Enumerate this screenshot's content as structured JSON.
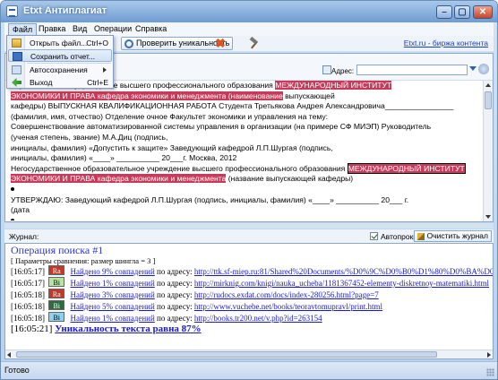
{
  "window": {
    "title": "Etxt Антиплагиат",
    "min_label": "–",
    "max_label": "▢",
    "close_label": "✕"
  },
  "menu": {
    "file": "Файл",
    "edit": "Правка",
    "view": "Вид",
    "operations": "Операции",
    "help": "Справка"
  },
  "file_menu": {
    "open": "Открыть файл...",
    "open_shortcut": "Ctrl+O",
    "save": "Сохранить отчет...",
    "autosave": "Автосохранения",
    "exit": "Выход",
    "exit_shortcut": "Ctrl+E"
  },
  "toolbar": {
    "check_button": "Проверить уникальность",
    "site_link": "Etxt.ru - биржа контента"
  },
  "address": {
    "label": "Адрес:",
    "value": ""
  },
  "document": {
    "l1a": "образовательное учреждение  высшего профессионального образования ",
    "l1b": "МЕЖДУНАРОДНЫЙ ИНСТИТУТ",
    "l2a": "ЭКОНОМИКИ И ПРАВА ",
    "l2b": "              кафедра экономики и менеджмента",
    "l2c": "              ",
    "l2d": "(наименование",
    "l2e": " выпускающей",
    "l3": "кафедры)   ВЫПУСКНАЯ КВАЛИФИКАЦИОННАЯ РАБОТА    Студента          Третьякова Андрея Александровича________________",
    "l4": "                              (фамилия, имя, отчество) Отделение      очное     Факультет экономики и управления на тему:",
    "l5": "Совершенствование автоматизированной системы управления в организации (на примере СФ МИЭП)    Руководитель",
    "l6": "                                         (ученая степень, звание)                                    М.А.Диц            (подпись,",
    "l7": "инициалы, фамилия)  «Допустить к защите» Заведующий  кафедрой                                     Л.П.Шургая (подпись,",
    "l8": "инициалы, фамилия) «____» __________ 20___г.      Москва, 2012",
    "l9a": "Негосударственное образовательное учреждение  высшего профессионального образования ",
    "l9b": "МЕЖДУНАРОДНЫЙ ИНСТИТУТ",
    "l10a": "ЭКОНОМИКИ И ПРАВА",
    "l10b": " кафедра экономики и менеджмента",
    "l10c": " (название выпускающей кафедры)",
    "l12": "УТВЕРЖДАЮ: Заведующий  кафедрой                Л.П.Шургая          (подпись, инициалы, фамилия)  «____» __________ 20___ г.",
    "l13": "(дата"
  },
  "journal": {
    "label": "Журнал:",
    "autoscroll_label": "Автопрокрутка",
    "autoscroll_checked": true,
    "clear_button": "Очистить журнал",
    "op_title": "Операция поиска #1",
    "params": "[ Параметры сравнения: размер шингла = 3 ]",
    "entries": [
      {
        "time": "[16:05:17]",
        "badge": "Ra",
        "badge_color": "#c0392b",
        "badge_text_color": "#ffffff",
        "text": "Найдено 9% совпадений",
        "suffix": " по адресу: ",
        "url": "http://ttk.sf-miep.ru:81/Shared%20Documents/%D0%9C%D0%B0%D1%80%D0%BA%D0%B5"
      },
      {
        "time": "[16:05:17]",
        "badge": "Bi",
        "badge_color": "#b7e4a3",
        "badge_text_color": "#000000",
        "text": "Найдено 1% совпадений",
        "suffix": " по адресу: ",
        "url": "http://mirknig.com/knigi/nauka_ucheba/1181367452-elementy-diskretnoy-matematiki.html"
      },
      {
        "time": "[16:05:18]",
        "badge": "Ra",
        "badge_color": "#c0392b",
        "badge_text_color": "#ffffff",
        "text": "Найдено 3% совпадений",
        "suffix": " по адресу: ",
        "url": "http://rudocs.exdat.com/docs/index-280256.html?page=7"
      },
      {
        "time": "[16:05:18]",
        "badge": "Bi",
        "badge_color": "#2e6b43",
        "badge_text_color": "#ffffff",
        "text": "Найдено 5% совпадений",
        "suffix": " по адресу: ",
        "url": "http://www.vuchebe.net/books/teoravtomupravl/print.html"
      },
      {
        "time": "[16:05:18]",
        "badge": "Bi",
        "badge_color": "#8fd0ee",
        "badge_text_color": "#000000",
        "text": "Найдено 1% совпадений",
        "suffix": " по адресу: ",
        "url": "http://books.tr200.net/v.php?id=263154"
      }
    ],
    "result_time": "[16:05:21]",
    "result_text": "Уникальность текста равна 87%"
  },
  "status": {
    "text": "Готово"
  }
}
